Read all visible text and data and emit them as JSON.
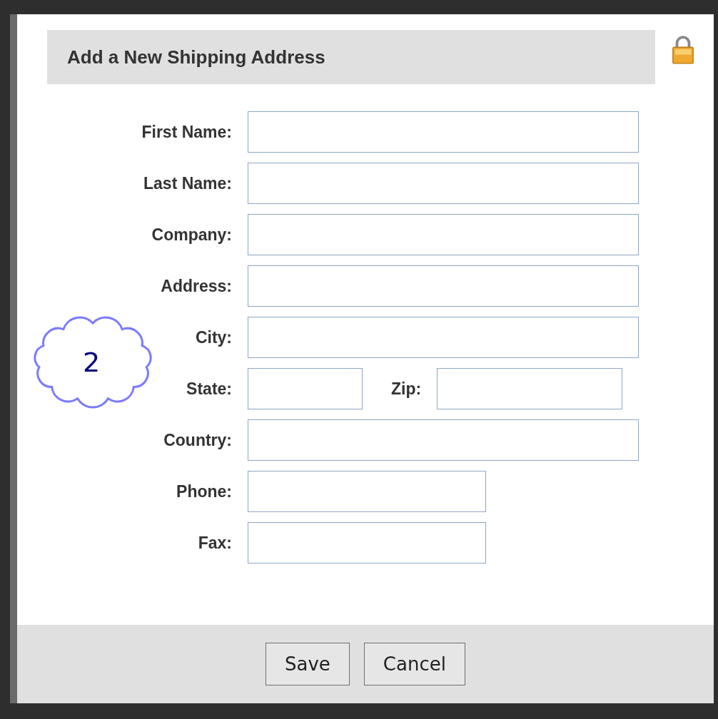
{
  "dialog": {
    "title": "Add a New Shipping Address"
  },
  "rows": [
    {
      "fields": [
        {
          "label": "First Name:",
          "kind": "wide"
        }
      ]
    },
    {
      "fields": [
        {
          "label": "Last Name:",
          "kind": "wide"
        }
      ]
    },
    {
      "fields": [
        {
          "label": "Company:",
          "kind": "wide"
        }
      ]
    },
    {
      "fields": [
        {
          "label": "Address:",
          "kind": "wide"
        }
      ]
    },
    {
      "fields": [
        {
          "label": "City:",
          "kind": "wide"
        }
      ]
    },
    {
      "fields": [
        {
          "label": "State:",
          "kind": "short"
        },
        {
          "label": "Zip:",
          "kind": "zip"
        }
      ]
    },
    {
      "fields": [
        {
          "label": "Country:",
          "kind": "wide"
        }
      ]
    },
    {
      "fields": [
        {
          "label": "Phone:",
          "kind": "medium"
        }
      ]
    },
    {
      "fields": [
        {
          "label": "Fax:",
          "kind": "medium"
        }
      ]
    }
  ],
  "callout": {
    "text": "2"
  },
  "buttons": [
    "Save",
    "Cancel"
  ]
}
